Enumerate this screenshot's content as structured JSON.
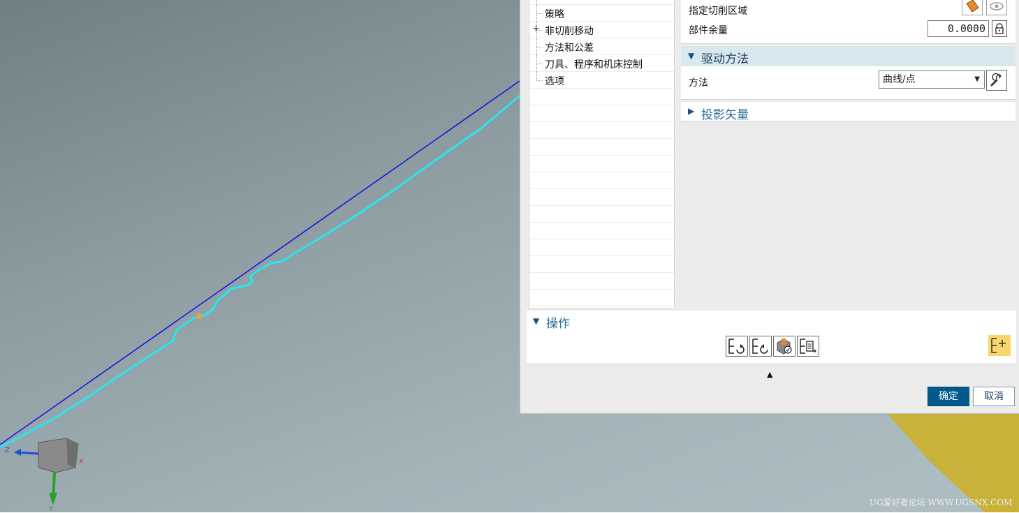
{
  "tree": {
    "items": [
      {
        "label": "策略",
        "expander": ""
      },
      {
        "label": "非切削移动",
        "expander": "+"
      },
      {
        "label": "方法和公差",
        "expander": ""
      },
      {
        "label": "刀具、程序和机床控制",
        "expander": ""
      },
      {
        "label": "选项",
        "expander": ""
      }
    ]
  },
  "geometry_group": {
    "cut_region_label": "指定切削区域",
    "stock_label": "部件余量",
    "stock_value": "0.0000"
  },
  "drive_method": {
    "title": "驱动方法",
    "method_label": "方法",
    "method_value": "曲线/点"
  },
  "projection_vector": {
    "title": "投影矢量"
  },
  "operations": {
    "title": "操作"
  },
  "dialog": {
    "ok_label": "确定",
    "cancel_label": "取消"
  },
  "viewport": {
    "axis_z": "Z",
    "axis_x": "X",
    "axis_y": "Y"
  },
  "watermark": "UG爱好者论坛 WWW.UGSNX.COM",
  "colors": {
    "ok_button": "#005a8c",
    "tool_path": "#28e6ee",
    "curve": "#1010e0",
    "part": "#c9b23a"
  }
}
